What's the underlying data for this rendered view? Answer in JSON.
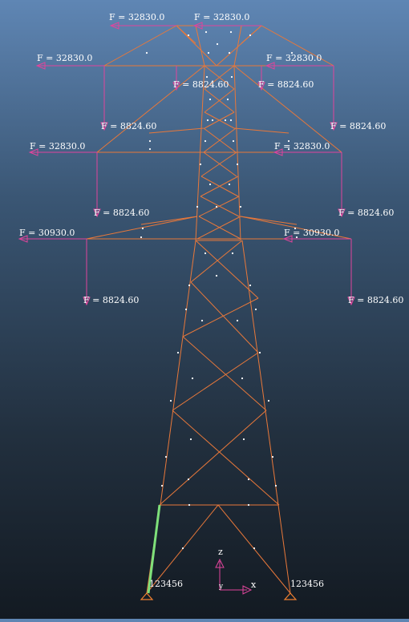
{
  "model": {
    "colors": {
      "background_top": "#5f86b4",
      "background_bottom": "#131a22",
      "member": "#e8783a",
      "selected_member": "#7ee07a",
      "load": "#e0449c",
      "support": "#f08030",
      "node": "#ffffff",
      "axis": "#e0449c"
    },
    "loads": [
      {
        "label": "F = 32830.0"
      },
      {
        "label": "F = 32830.0"
      },
      {
        "label": "F = 32830.0"
      },
      {
        "label": "F = 32830.0"
      },
      {
        "label": "F = 8824.60"
      },
      {
        "label": "F = 8824.60"
      },
      {
        "label": "F = 8824.60"
      },
      {
        "label": "F = 8824.60"
      },
      {
        "label": "F = 32830.0"
      },
      {
        "label": "F = 32830.0"
      },
      {
        "label": "F = 8824.60"
      },
      {
        "label": "F = 8824.60"
      },
      {
        "label": "F = 30930.0"
      },
      {
        "label": "F = 30930.0"
      },
      {
        "label": "F = 8824.60"
      },
      {
        "label": "F = 8824.60"
      }
    ],
    "supports": [
      {
        "label": "123456"
      },
      {
        "label": "123456"
      }
    ],
    "axes": {
      "z": "z",
      "y": "y",
      "x": "x"
    }
  }
}
